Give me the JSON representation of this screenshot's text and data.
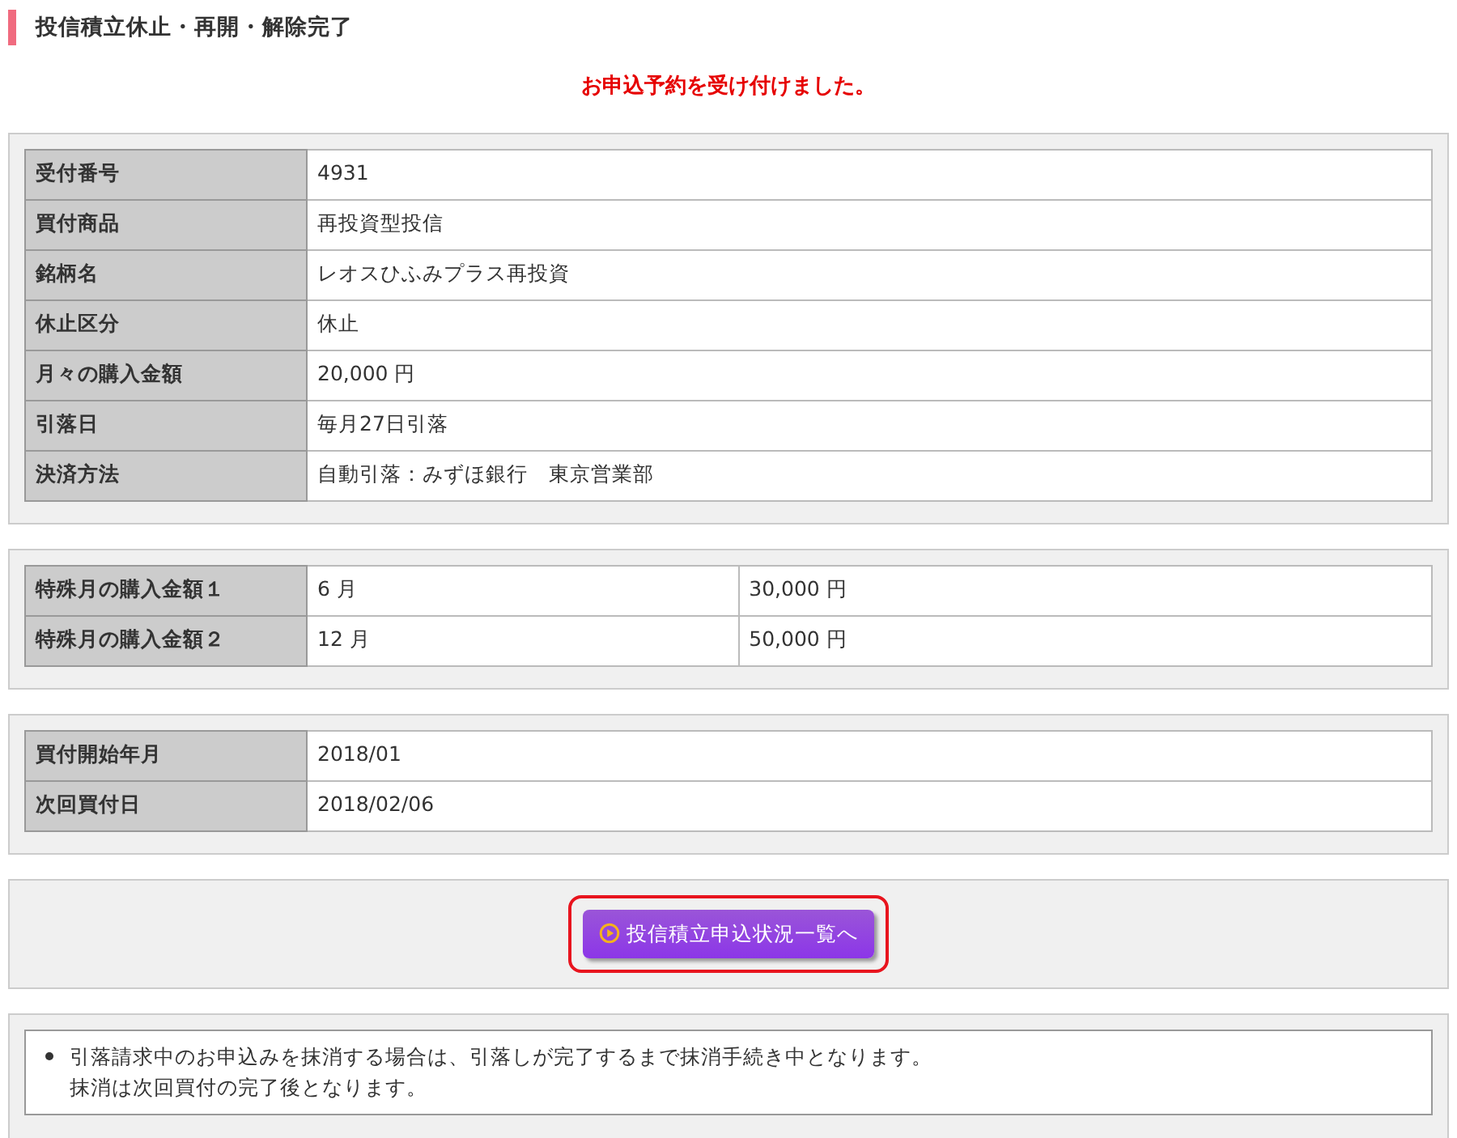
{
  "title": "投信積立休止・再開・解除完了",
  "message": "お申込予約を受け付けました。",
  "details": [
    {
      "label": "受付番号",
      "value": "4931"
    },
    {
      "label": "買付商品",
      "value": "再投資型投信"
    },
    {
      "label": "銘柄名",
      "value": "レオスひふみプラス再投資"
    },
    {
      "label": "休止区分",
      "value": "休止"
    },
    {
      "label": "月々の購入金額",
      "value": "20,000 円"
    },
    {
      "label": "引落日",
      "value": "毎月27日引落"
    },
    {
      "label": "決済方法",
      "value": "自動引落：みずほ銀行　東京営業部"
    }
  ],
  "special_months": [
    {
      "label": "特殊月の購入金額１",
      "month": "6 月",
      "amount": "30,000 円"
    },
    {
      "label": "特殊月の購入金額２",
      "month": "12 月",
      "amount": "50,000 円"
    }
  ],
  "schedule": [
    {
      "label": "買付開始年月",
      "value": "2018/01"
    },
    {
      "label": "次回買付日",
      "value": "2018/02/06"
    }
  ],
  "button": {
    "label": "投信積立申込状況一覧へ",
    "highlighted": true
  },
  "notes": [
    {
      "lines": [
        "引落請求中のお申込みを抹消する場合は、引落しが完了するまで抹消手続き中となります。",
        "抹消は次回買付の完了後となります。"
      ]
    }
  ]
}
